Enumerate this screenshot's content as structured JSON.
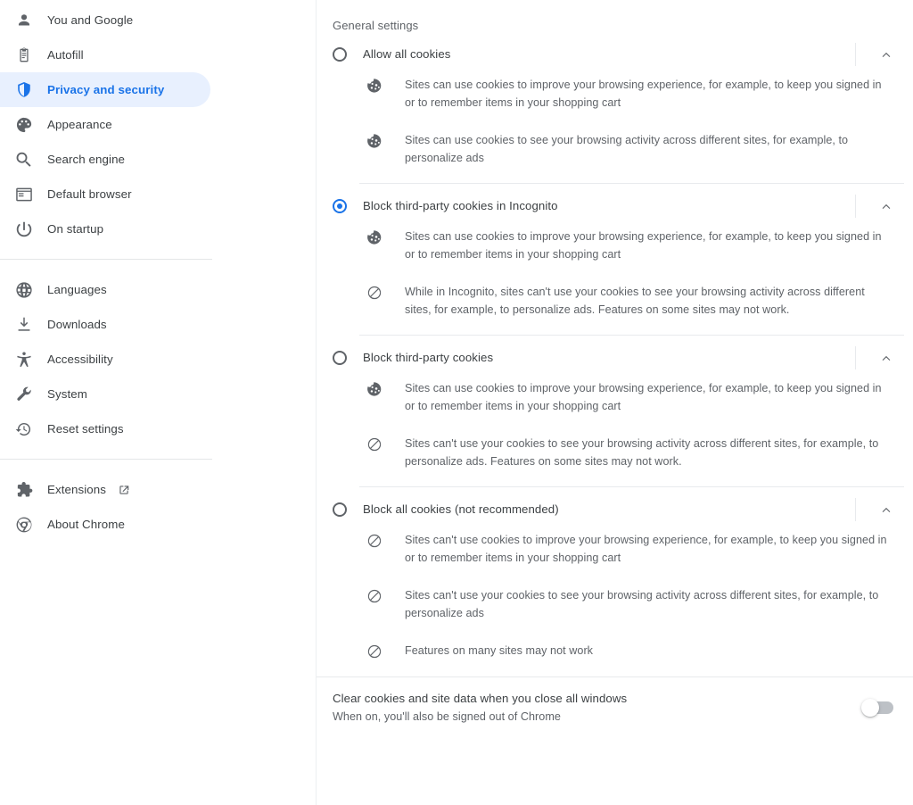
{
  "sidebar": {
    "groups": [
      {
        "items": [
          {
            "label": "You and Google",
            "icon": "person-icon",
            "selected": false,
            "external": false
          },
          {
            "label": "Autofill",
            "icon": "clipboard-icon",
            "selected": false,
            "external": false
          },
          {
            "label": "Privacy and security",
            "icon": "shield-icon",
            "selected": true,
            "external": false
          },
          {
            "label": "Appearance",
            "icon": "palette-icon",
            "selected": false,
            "external": false
          },
          {
            "label": "Search engine",
            "icon": "search-icon",
            "selected": false,
            "external": false
          },
          {
            "label": "Default browser",
            "icon": "browser-window-icon",
            "selected": false,
            "external": false
          },
          {
            "label": "On startup",
            "icon": "power-icon",
            "selected": false,
            "external": false
          }
        ]
      },
      {
        "items": [
          {
            "label": "Languages",
            "icon": "globe-icon",
            "selected": false,
            "external": false
          },
          {
            "label": "Downloads",
            "icon": "download-icon",
            "selected": false,
            "external": false
          },
          {
            "label": "Accessibility",
            "icon": "accessibility-icon",
            "selected": false,
            "external": false
          },
          {
            "label": "System",
            "icon": "wrench-icon",
            "selected": false,
            "external": false
          },
          {
            "label": "Reset settings",
            "icon": "history-restore-icon",
            "selected": false,
            "external": false
          }
        ]
      },
      {
        "items": [
          {
            "label": "Extensions",
            "icon": "puzzle-piece-icon",
            "selected": false,
            "external": true
          },
          {
            "label": "About Chrome",
            "icon": "chrome-logo-icon",
            "selected": false,
            "external": false
          }
        ]
      }
    ]
  },
  "main": {
    "section_title": "General settings",
    "options": [
      {
        "id": "allow-all-cookies",
        "label": "Allow all cookies",
        "selected": false,
        "expanded": true,
        "chevron": "chevron-up-icon",
        "bullets": [
          {
            "icon": "cookie-icon",
            "text": "Sites can use cookies to improve your browsing experience, for example, to keep you signed in or to remember items in your shopping cart"
          },
          {
            "icon": "cookie-icon",
            "text": "Sites can use cookies to see your browsing activity across different sites, for example, to personalize ads"
          }
        ]
      },
      {
        "id": "block-third-party-incognito",
        "label": "Block third-party cookies in Incognito",
        "selected": true,
        "expanded": true,
        "chevron": "chevron-up-icon",
        "bullets": [
          {
            "icon": "cookie-icon",
            "text": "Sites can use cookies to improve your browsing experience, for example, to keep you signed in or to remember items in your shopping cart"
          },
          {
            "icon": "block-icon",
            "text": "While in Incognito, sites can't use your cookies to see your browsing activity across different sites, for example, to personalize ads. Features on some sites may not work."
          }
        ]
      },
      {
        "id": "block-third-party",
        "label": "Block third-party cookies",
        "selected": false,
        "expanded": true,
        "chevron": "chevron-up-icon",
        "bullets": [
          {
            "icon": "cookie-icon",
            "text": "Sites can use cookies to improve your browsing experience, for example, to keep you signed in or to remember items in your shopping cart"
          },
          {
            "icon": "block-icon",
            "text": "Sites can't use your cookies to see your browsing activity across different sites, for example, to personalize ads. Features on some sites may not work."
          }
        ]
      },
      {
        "id": "block-all-cookies",
        "label": "Block all cookies (not recommended)",
        "selected": false,
        "expanded": true,
        "chevron": "chevron-up-icon",
        "bullets": [
          {
            "icon": "block-icon",
            "text": "Sites can't use cookies to improve your browsing experience, for example, to keep you signed in or to remember items in your shopping cart"
          },
          {
            "icon": "block-icon",
            "text": "Sites can't use your cookies to see your browsing activity across different sites, for example, to personalize ads"
          },
          {
            "icon": "block-icon",
            "text": "Features on many sites may not work"
          }
        ]
      }
    ],
    "footer": {
      "title": "Clear cookies and site data when you close all windows",
      "subtitle": "When on, you'll also be signed out of Chrome",
      "toggle_on": false
    }
  },
  "colors": {
    "accent": "#1a73e8",
    "accent_bg": "#e8f0fe",
    "text_primary": "#3c4043",
    "text_secondary": "#5f6368",
    "divider": "#e8eaed"
  }
}
